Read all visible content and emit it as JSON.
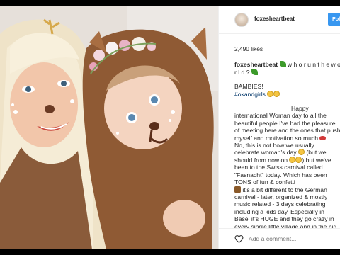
{
  "post": {
    "username": "foxesheartbeat",
    "follow_label": "Follow",
    "likes": "2,490 likes",
    "caption_user": "foxesheartbeat",
    "caption_line1": "w h o r u n t h e w o r l d ?",
    "bambies": "BAMBIES!",
    "hashtag": "#okandgirls",
    "para1": "Happy international Woman day to all the beautiful people I've had the pleasure of meeting here and the ones that push myself and motivation so much",
    "para2": "No, this is not how we usually celebrate woman's day",
    "para2b": "(but we should from now on",
    "para2c": ") but we've been to the Swiss carnival called \"Fasnacht\" today. Which has been TONS of fun & confetti",
    "para3": "it's a bit different to the German carnival - later, organized & mostly music related - 3 days celebrating including a kids day. Especially in Basel it's HUGE and they go crazy in every single little village and in the big city",
    "add_comment_placeholder": "Add a comment..."
  },
  "icons": {
    "leaf": "leaf-emoji",
    "lips": "lips-emoji",
    "smile": "smile-emoji",
    "dancer": "dancer-emoji",
    "heart": "heart-icon"
  },
  "colors": {
    "follow": "#3897f0",
    "text": "#262626",
    "hashtag": "#003569",
    "placeholder": "#b0b0b0"
  }
}
